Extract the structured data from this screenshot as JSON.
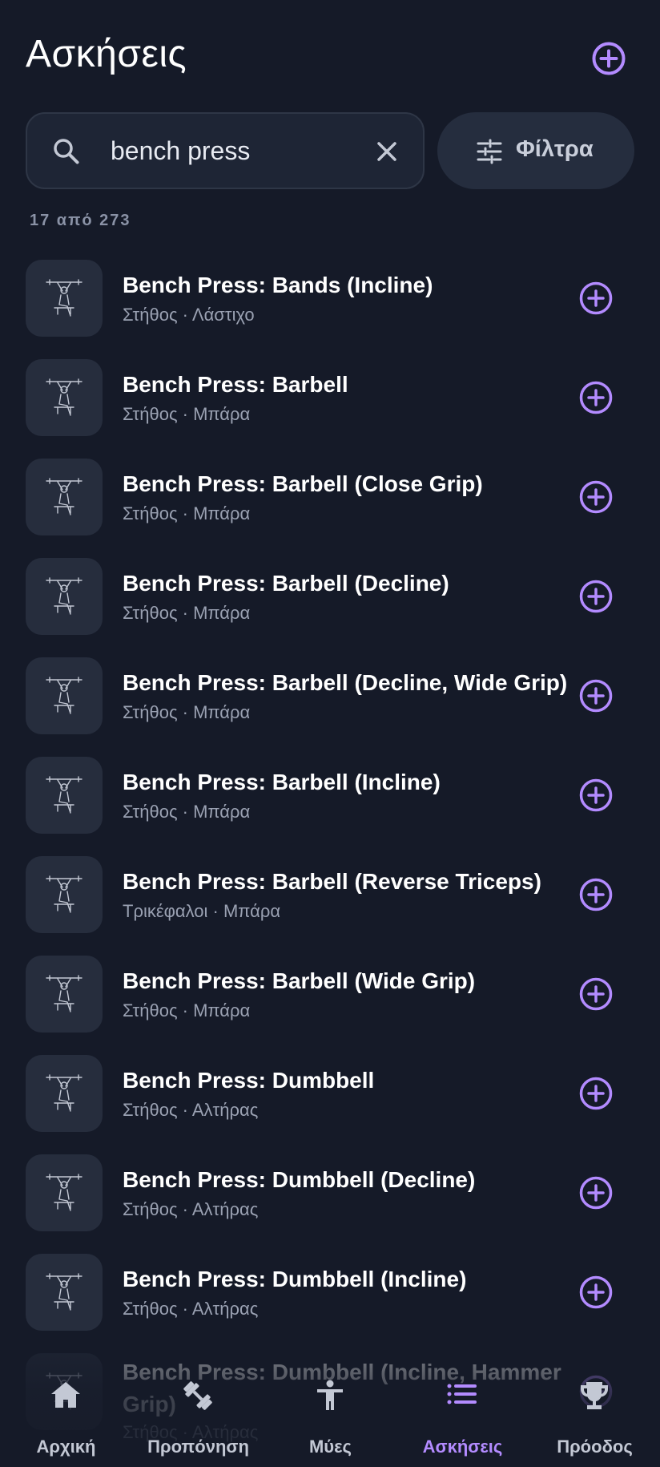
{
  "header": {
    "title": "Ασκήσεις",
    "add_icon": "plus-circle-icon"
  },
  "search": {
    "value": "bench press",
    "search_icon": "search-icon",
    "clear_icon": "close-icon"
  },
  "filter": {
    "label": "Φίλτρα",
    "icon": "sliders-icon"
  },
  "results_count": "17 από 273",
  "colors": {
    "background": "#151a28",
    "accent": "#b38bff",
    "card": "#262d3d",
    "muted_text": "#9aa1b2"
  },
  "exercises": [
    {
      "title": "Bench Press: Bands (Incline)",
      "subtitle": "Στήθος · Λάστιχο"
    },
    {
      "title": "Bench Press: Barbell",
      "subtitle": "Στήθος · Μπάρα"
    },
    {
      "title": "Bench Press: Barbell (Close Grip)",
      "subtitle": "Στήθος · Μπάρα"
    },
    {
      "title": "Bench Press: Barbell (Decline)",
      "subtitle": "Στήθος · Μπάρα"
    },
    {
      "title": "Bench Press: Barbell (Decline, Wide Grip)",
      "subtitle": "Στήθος · Μπάρα"
    },
    {
      "title": "Bench Press: Barbell (Incline)",
      "subtitle": "Στήθος · Μπάρα"
    },
    {
      "title": "Bench Press: Barbell (Reverse Triceps)",
      "subtitle": "Τρικέφαλοι · Μπάρα"
    },
    {
      "title": "Bench Press: Barbell (Wide Grip)",
      "subtitle": "Στήθος · Μπάρα"
    },
    {
      "title": "Bench Press: Dumbbell",
      "subtitle": "Στήθος · Αλτήρας"
    },
    {
      "title": "Bench Press: Dumbbell (Decline)",
      "subtitle": "Στήθος · Αλτήρας"
    },
    {
      "title": "Bench Press: Dumbbell (Incline)",
      "subtitle": "Στήθος · Αλτήρας"
    },
    {
      "title": "Bench Press: Dumbbell (Incline, Hammer Grip)",
      "subtitle": "Στήθος · Αλτήρας"
    }
  ],
  "bottom_nav": [
    {
      "label": "Αρχική",
      "icon": "home-icon",
      "active": false
    },
    {
      "label": "Προπόνηση",
      "icon": "dumbbell-icon",
      "active": false
    },
    {
      "label": "Μύες",
      "icon": "body-icon",
      "active": false
    },
    {
      "label": "Ασκήσεις",
      "icon": "list-icon",
      "active": true
    },
    {
      "label": "Πρόοδος",
      "icon": "trophy-icon",
      "active": false
    }
  ]
}
